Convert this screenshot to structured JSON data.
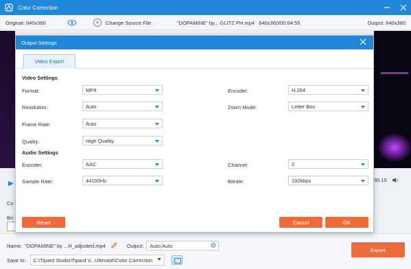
{
  "window": {
    "title": "Color Correction"
  },
  "infobar": {
    "original": "Original: 640x360",
    "change_source": "Change Source File",
    "file_name": "\"DOPAMINE\" by... GLITZ PH.mp4",
    "file_info": "640x360/00:04:55",
    "output": "Output: 640x360"
  },
  "player": {
    "time_fragment": "55.15"
  },
  "background_fragments": {
    "co": "Co",
    "bri": "Bri"
  },
  "dialog": {
    "title": "Output Settings",
    "tab": "Video Export",
    "video_section": "Video Settings",
    "audio_section": "Audio Settings",
    "video": {
      "format_label": "Format:",
      "format_value": "MP4",
      "encoder_label": "Encoder:",
      "encoder_value": "H.264",
      "resolution_label": "Resolution:",
      "resolution_value": "Auto",
      "zoom_label": "Zoom Mode:",
      "zoom_value": "Letter Box",
      "framerate_label": "Frame Rate:",
      "framerate_value": "Auto",
      "quality_label": "Quality:",
      "quality_value": "High Quality"
    },
    "audio": {
      "encoder_label": "Encoder:",
      "encoder_value": "AAC",
      "channel_label": "Channel:",
      "channel_value": "2",
      "samplerate_label": "Sample Rate:",
      "samplerate_value": "44100Hz",
      "bitrate_label": "Bitrate:",
      "bitrate_value": "192kbps"
    },
    "buttons": {
      "reset": "Reset",
      "cancel": "Cancel",
      "ok": "OK"
    }
  },
  "bottom": {
    "name_label": "Name:",
    "name_value": "\"DOPAMINE\" by ...H_adjusted.mp4",
    "output_label": "Output:",
    "output_value": "Auto;Auto",
    "save_label": "Save to:",
    "save_path": "C:\\Tipard Studio\\Tipard V...Ultimate\\Color Correction",
    "export": "Export"
  },
  "colors": {
    "accent": "#1f86d8",
    "action": "#ef6b3c"
  }
}
